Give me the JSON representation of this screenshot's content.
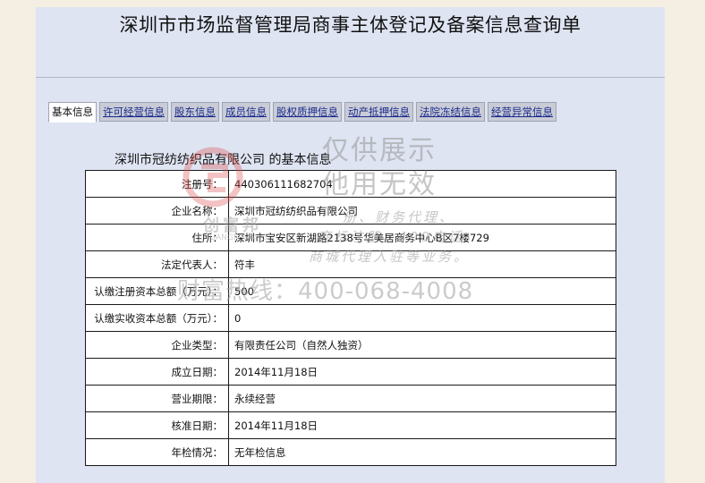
{
  "page_title": "深圳市市场监督管理局商事主体登记及备案信息查询单",
  "tabs": [
    {
      "label": "基本信息",
      "active": true
    },
    {
      "label": "许可经营信息",
      "active": false
    },
    {
      "label": "股东信息",
      "active": false
    },
    {
      "label": "成员信息",
      "active": false
    },
    {
      "label": "股权质押信息",
      "active": false
    },
    {
      "label": "动产抵押信息",
      "active": false
    },
    {
      "label": "法院冻结信息",
      "active": false
    },
    {
      "label": "经营异常信息",
      "active": false
    }
  ],
  "section_title": "深圳市冠纺纺织品有限公司 的基本信息",
  "rows": [
    {
      "label": "注册号：",
      "value": "440306111682704"
    },
    {
      "label": "企业名称：",
      "value": "深圳市冠纺纺织品有限公司"
    },
    {
      "label": "住所：",
      "value": "深圳市宝安区新湖路2138号华美居商务中心B区7楼729"
    },
    {
      "label": "法定代表人：",
      "value": "符丰"
    },
    {
      "label": "认缴注册资本总额（万元）：",
      "value": "500"
    },
    {
      "label": "认缴实收资本总额（万元）：",
      "value": "0"
    },
    {
      "label": "企业类型：",
      "value": "有限责任公司（自然人独资）"
    },
    {
      "label": "成立日期：",
      "value": "2014年11月18日"
    },
    {
      "label": "营业期限：",
      "value": "永续经营"
    },
    {
      "label": "核准日期：",
      "value": "2014年11月18日"
    },
    {
      "label": "年检情况：",
      "value": "无年检信息"
    }
  ],
  "watermark": {
    "line1": "仅供展示",
    "line2": "他用无效",
    "line3": "册、财务代理、",
    "line4": "商标注册、400电话",
    "line5": "商城代理入驻等业务。",
    "phone": "财富热线：400-068-4008",
    "logo_text": "创富邦",
    "logo_sub": "CHUANGFUBANG",
    "logo_color": "#d9534f"
  },
  "colors": {
    "page_bg": "#f5efe3",
    "frame_bg": "#dee4f2",
    "tab_bg": "#c9ccd6",
    "tab_link": "#1a2a8c"
  }
}
